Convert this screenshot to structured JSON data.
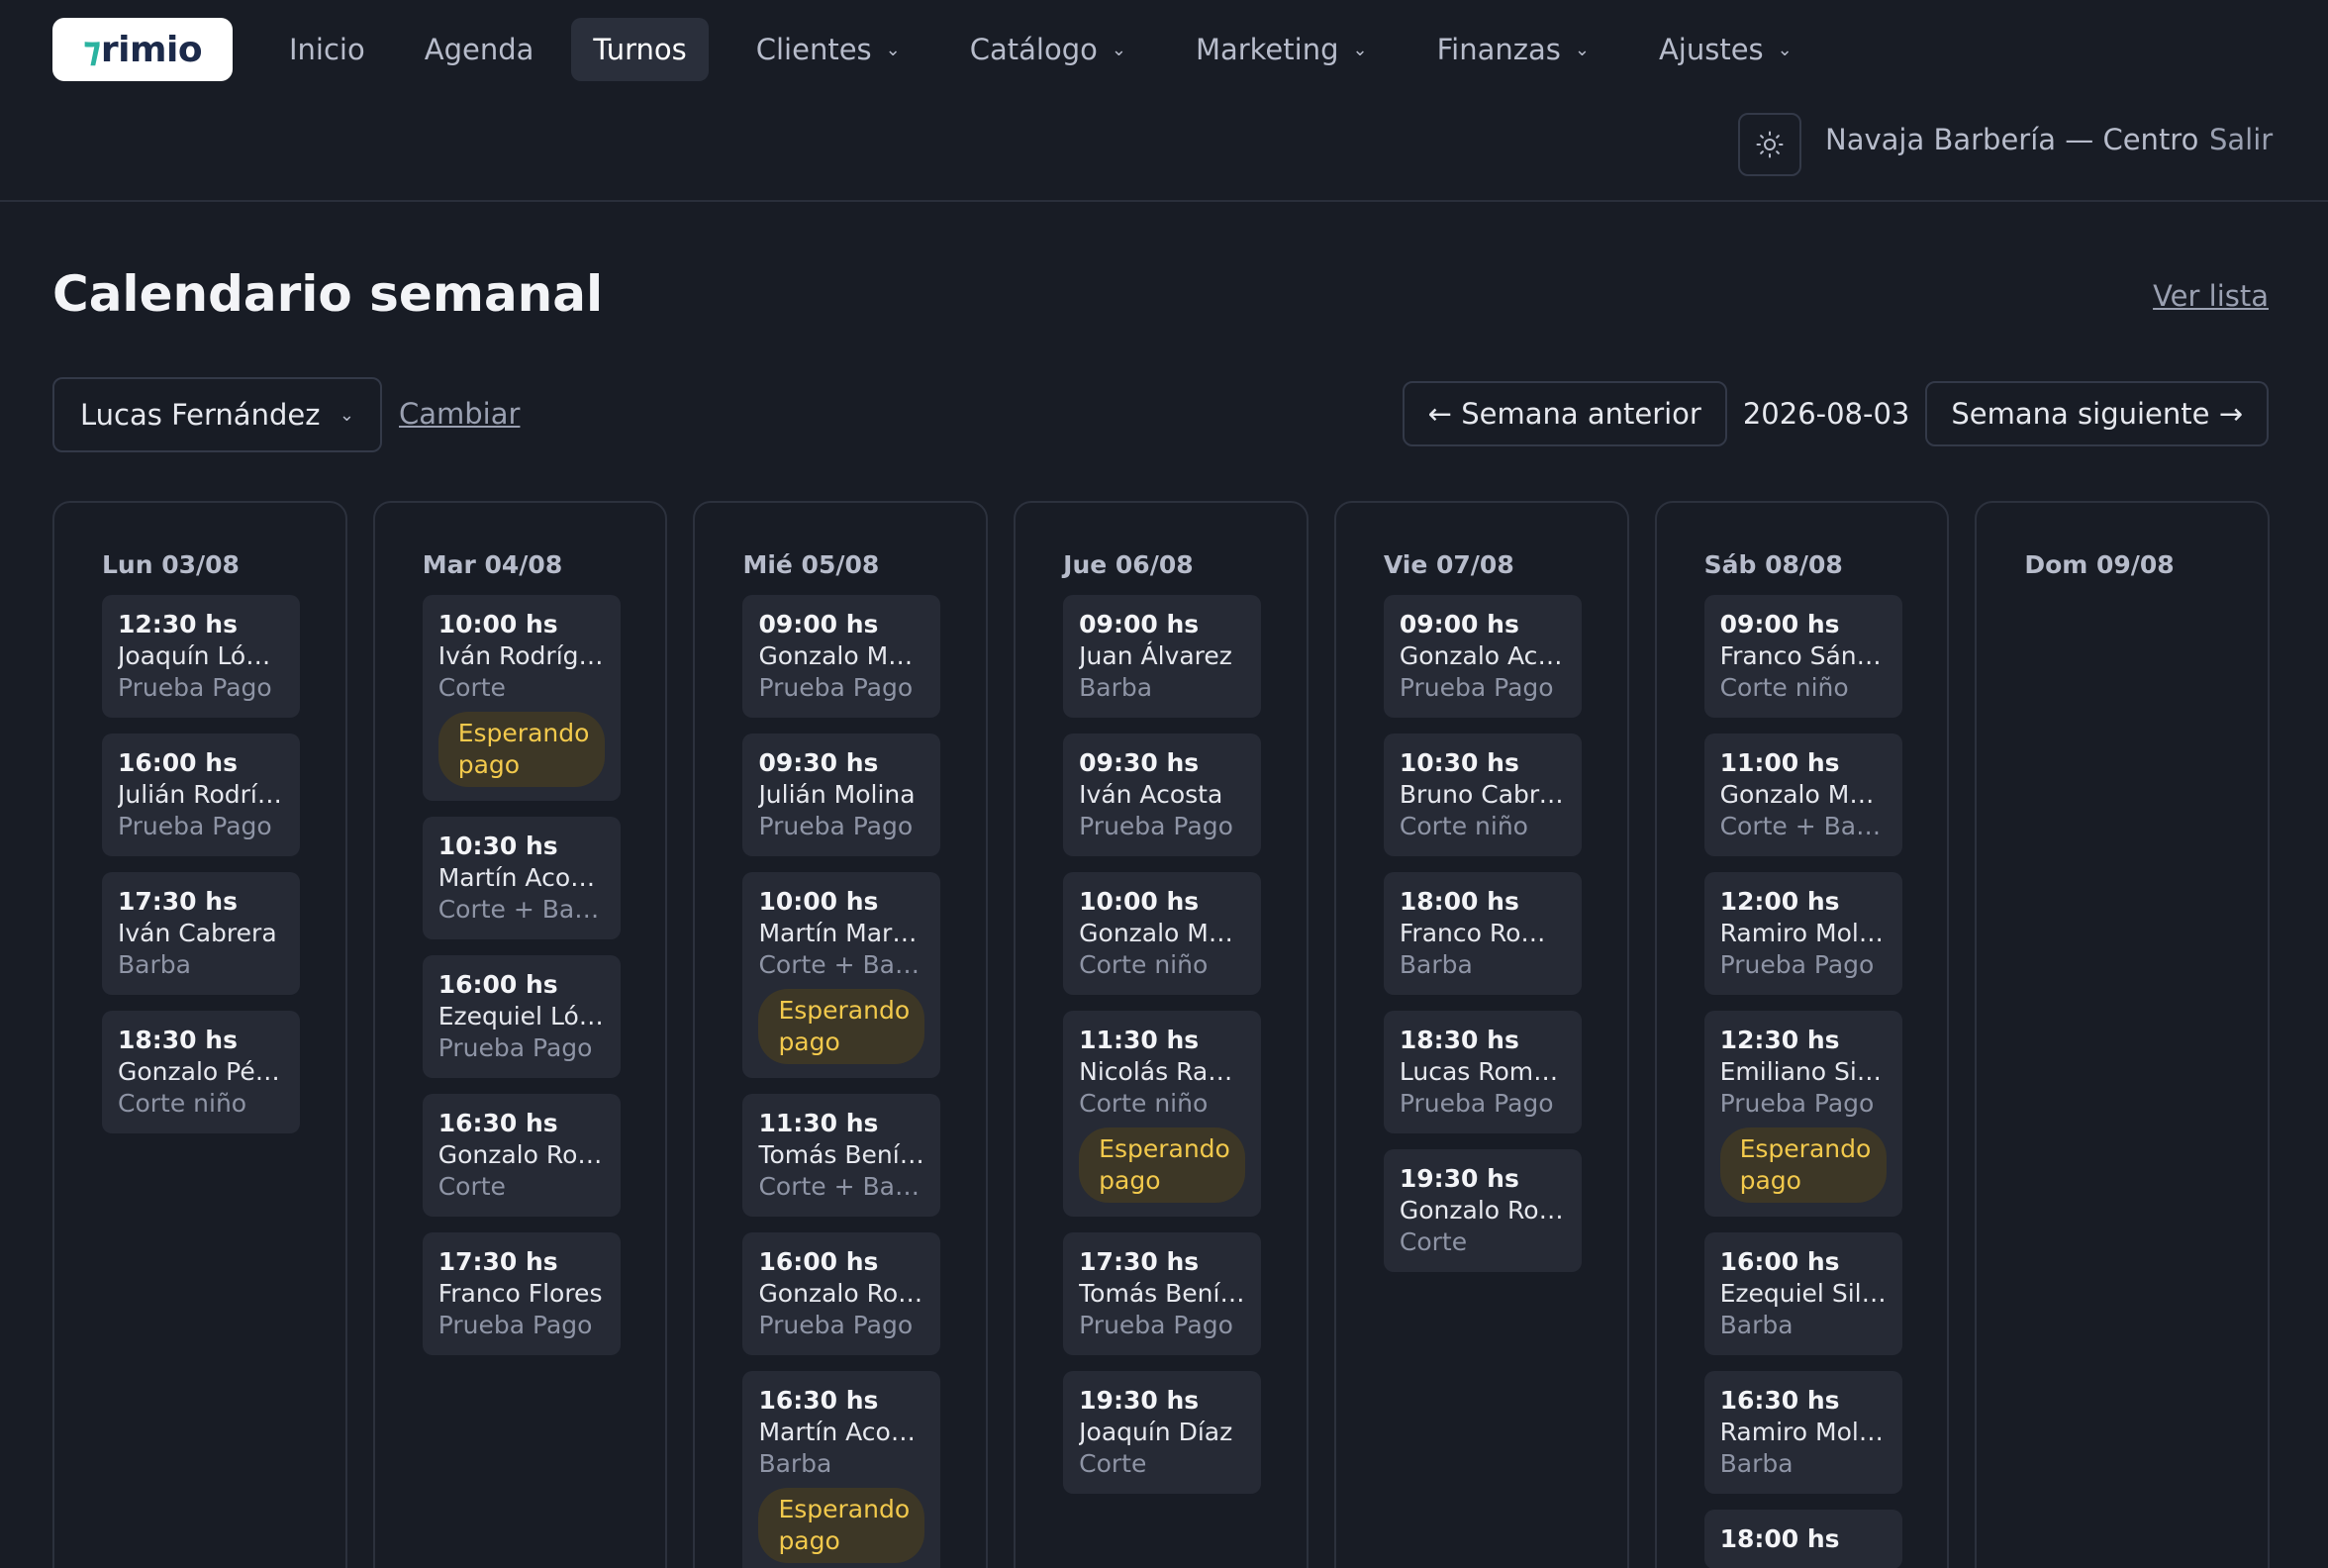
{
  "brand": {
    "logo_text": "rimio",
    "logo_mark": "⁊"
  },
  "nav": {
    "items": [
      {
        "label": "Inicio"
      },
      {
        "label": "Agenda"
      },
      {
        "label": "Turnos"
      },
      {
        "label": "Clientes"
      },
      {
        "label": "Catálogo"
      },
      {
        "label": "Marketing"
      },
      {
        "label": "Finanzas"
      },
      {
        "label": "Ajustes"
      }
    ],
    "active": "Turnos"
  },
  "header": {
    "business": "Navaja Barbería — Centro",
    "logout": "Salir"
  },
  "page": {
    "title": "Calendario semanal",
    "view_list": "Ver lista"
  },
  "controls": {
    "barber": "Lucas Fernández",
    "change": "Cambiar",
    "prev_week": "← Semana anterior",
    "week_date": "2026-08-03",
    "next_week": "Semana siguiente →"
  },
  "badge_label": "Esperando pago",
  "colors": {
    "background": "#181c25",
    "card": "#262a35",
    "badge_bg": "#3d3726",
    "badge_text": "#f2c94c"
  },
  "days": [
    {
      "label": "Lun 03/08",
      "appointments": [
        {
          "time": "12:30 hs",
          "client": "Joaquín López",
          "service": "Prueba Pago"
        },
        {
          "time": "16:00 hs",
          "client": "Julián Rodríguez",
          "service": "Prueba Pago"
        },
        {
          "time": "17:30 hs",
          "client": "Iván Cabrera",
          "service": "Barba"
        },
        {
          "time": "18:30 hs",
          "client": "Gonzalo Pérez",
          "service": "Corte niño"
        }
      ]
    },
    {
      "label": "Mar 04/08",
      "appointments": [
        {
          "time": "10:00 hs",
          "client": "Iván Rodríguez",
          "service": "Corte",
          "badge": "Esperando pago"
        },
        {
          "time": "10:30 hs",
          "client": "Martín Acosta",
          "service": "Corte + Barba"
        },
        {
          "time": "16:00 hs",
          "client": "Ezequiel López",
          "service": "Prueba Pago"
        },
        {
          "time": "16:30 hs",
          "client": "Gonzalo Romero",
          "service": "Corte"
        },
        {
          "time": "17:30 hs",
          "client": "Franco Flores",
          "service": "Prueba Pago"
        }
      ]
    },
    {
      "label": "Mié 05/08",
      "appointments": [
        {
          "time": "09:00 hs",
          "client": "Gonzalo Martínez",
          "service": "Prueba Pago"
        },
        {
          "time": "09:30 hs",
          "client": "Julián Molina",
          "service": "Prueba Pago"
        },
        {
          "time": "10:00 hs",
          "client": "Martín Martínez",
          "service": "Corte + Barba",
          "badge": "Esperando pago"
        },
        {
          "time": "11:30 hs",
          "client": "Tomás Benítez",
          "service": "Corte + Barba"
        },
        {
          "time": "16:00 hs",
          "client": "Gonzalo Romero",
          "service": "Prueba Pago"
        },
        {
          "time": "16:30 hs",
          "client": "Martín Acosta",
          "service": "Barba",
          "badge": "Esperando pago"
        }
      ]
    },
    {
      "label": "Jue 06/08",
      "appointments": [
        {
          "time": "09:00 hs",
          "client": "Juan Álvarez",
          "service": "Barba"
        },
        {
          "time": "09:30 hs",
          "client": "Iván Acosta",
          "service": "Prueba Pago"
        },
        {
          "time": "10:00 hs",
          "client": "Gonzalo Martínez",
          "service": "Corte niño"
        },
        {
          "time": "11:30 hs",
          "client": "Nicolás Ramírez",
          "service": "Corte niño",
          "badge": "Esperando pago"
        },
        {
          "time": "17:30 hs",
          "client": "Tomás Benítez",
          "service": "Prueba Pago"
        },
        {
          "time": "19:30 hs",
          "client": "Joaquín Díaz",
          "service": "Corte"
        }
      ]
    },
    {
      "label": "Vie 07/08",
      "appointments": [
        {
          "time": "09:00 hs",
          "client": "Gonzalo Acosta",
          "service": "Prueba Pago"
        },
        {
          "time": "10:30 hs",
          "client": "Bruno Cabrera",
          "service": "Corte niño"
        },
        {
          "time": "18:00 hs",
          "client": "Franco Romero",
          "service": "Barba"
        },
        {
          "time": "18:30 hs",
          "client": "Lucas Romero",
          "service": "Prueba Pago"
        },
        {
          "time": "19:30 hs",
          "client": "Gonzalo Rodríguez",
          "service": "Corte"
        }
      ]
    },
    {
      "label": "Sáb 08/08",
      "appointments": [
        {
          "time": "09:00 hs",
          "client": "Franco Sánchez",
          "service": "Corte niño"
        },
        {
          "time": "11:00 hs",
          "client": "Gonzalo Molina",
          "service": "Corte + Barba"
        },
        {
          "time": "12:00 hs",
          "client": "Ramiro Molina",
          "service": "Prueba Pago"
        },
        {
          "time": "12:30 hs",
          "client": "Emiliano Silva",
          "service": "Prueba Pago",
          "badge": "Esperando pago"
        },
        {
          "time": "16:00 hs",
          "client": "Ezequiel Silva",
          "service": "Barba"
        },
        {
          "time": "16:30 hs",
          "client": "Ramiro Molina",
          "service": "Barba"
        },
        {
          "time": "18:00 hs",
          "client": "",
          "service": ""
        }
      ]
    },
    {
      "label": "Dom 09/08",
      "appointments": []
    }
  ]
}
